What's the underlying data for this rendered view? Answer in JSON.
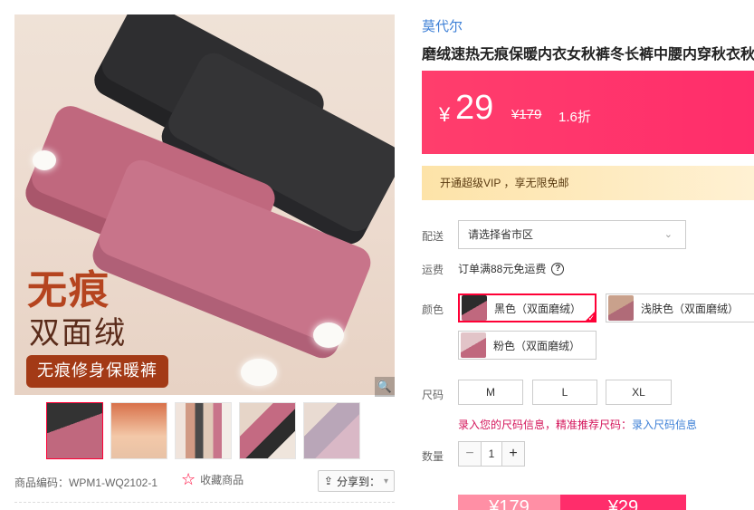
{
  "gallery": {
    "promo_line1": "无痕",
    "promo_line2": "双面绒",
    "promo_tag": "无痕修身保暖裤",
    "zoom_icon": "magnifier-icon",
    "thumb_count": 5,
    "active_thumb": 1
  },
  "footer": {
    "sku_code": "商品编码：WPM1-WQ2102-1",
    "favorite_label": "收藏商品",
    "favorite_icon": "star-outline-icon",
    "share_label": "分享到：",
    "share_icon": "share-arrow-icon"
  },
  "product": {
    "brand": "莫代尔",
    "title": "磨绒速热无痕保暖内衣女秋裤冬长裤中腰内穿秋衣秋"
  },
  "price": {
    "currency": "¥",
    "current": "29",
    "original": "¥179",
    "discount": "1.6折",
    "accent_color": "#ff2d6b"
  },
  "vip": {
    "text": "开通超级VIP ，享无限免邮"
  },
  "delivery": {
    "label": "配送",
    "placeholder": "请选择省市区"
  },
  "shipping": {
    "label": "运费",
    "text": "订单满88元免运费"
  },
  "color": {
    "label": "颜色",
    "options": [
      {
        "label": "黑色（双面磨绒）",
        "selected": true
      },
      {
        "label": "浅肤色（双面磨绒）",
        "selected": false
      },
      {
        "label": "粉色（双面磨绒）",
        "selected": false
      }
    ]
  },
  "size": {
    "label": "尺码",
    "options": [
      "M",
      "L",
      "XL"
    ],
    "hint_prefix": "录入您的尺码信息，精准推荐尺码：",
    "hint_link": "录入尺码信息"
  },
  "quantity": {
    "label": "数量",
    "value": "1",
    "minus": "−",
    "plus": "+"
  },
  "buy": {
    "left_text": "¥179",
    "right_text": "¥29"
  }
}
